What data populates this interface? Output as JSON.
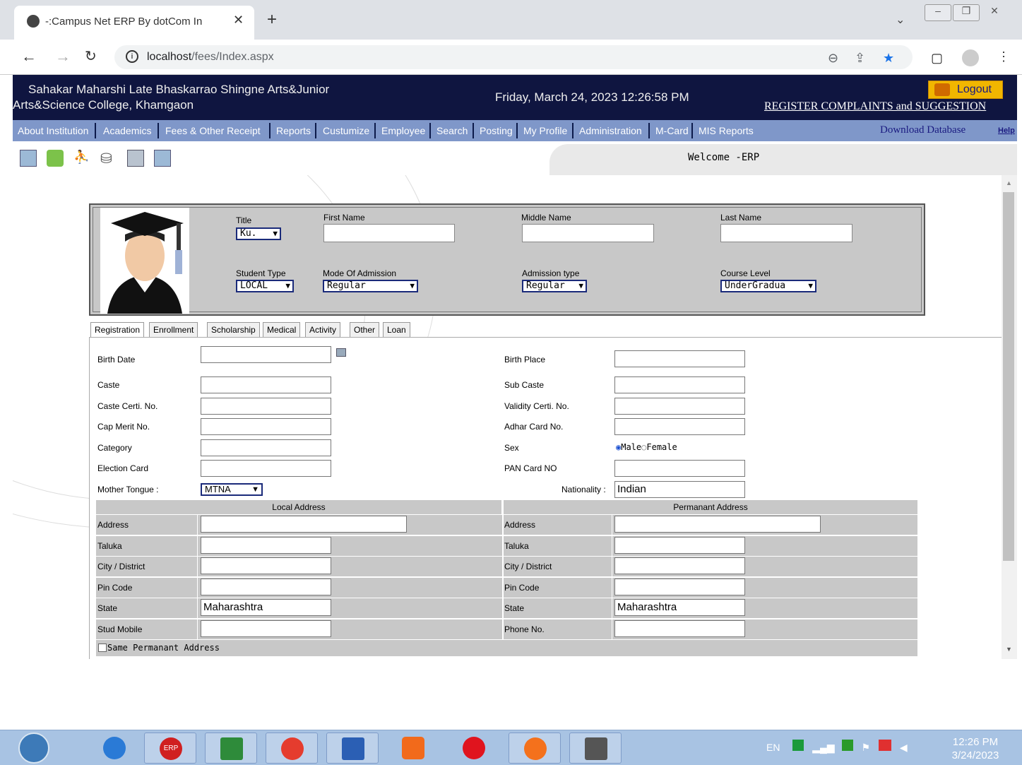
{
  "browser": {
    "tab_title": "-:Campus Net ERP By dotCom In",
    "url_host": "localhost",
    "url_path": "/fees/Index.aspx"
  },
  "header": {
    "college_line1": "Sahakar Maharshi Late Bhaskarrao Shingne Arts&Junior",
    "college_line2": "Arts&Science College, Khamgaon",
    "datetime": "Friday, March 24, 2023 12:26:58 PM",
    "logout": "Logout",
    "complaints": "REGISTER COMPLAINTS and SUGGESTION"
  },
  "menu": {
    "items": [
      "About Institution",
      "Academics",
      "Fees & Other Receipt",
      "Reports",
      "Custumize",
      "Employee",
      "Search",
      "Posting",
      "My Profile",
      "Administration",
      "M-Card",
      "MIS Reports"
    ],
    "download": "Download Database",
    "help": "Help"
  },
  "welcome": "Welcome -ERP",
  "profile": {
    "title_label": "Title",
    "title_value": "Ku.",
    "first_name_label": "First Name",
    "middle_name_label": "Middle Name",
    "last_name_label": "Last Name",
    "student_type_label": "Student Type",
    "student_type_value": "LOCAL",
    "mode_label": "Mode Of Admission",
    "mode_value": "Regular",
    "adm_type_label": "Admission type",
    "adm_type_value": "Regular",
    "course_level_label": "Course Level",
    "course_level_value": "UnderGradua"
  },
  "tabs": [
    "Registration",
    "Enrollment",
    "Scholarship",
    "Medical",
    "Activity",
    "Other",
    "Loan"
  ],
  "form": {
    "birth_date": "Birth Date",
    "birth_place": "Birth Place",
    "caste": "Caste",
    "sub_caste": "Sub Caste",
    "caste_certi": "Caste Certi. No.",
    "validity_certi": "Validity Certi. No.",
    "cap_merit": "Cap Merit No.",
    "adhar": "Adhar Card No.",
    "category": "Category",
    "sex": "Sex",
    "male": "Male",
    "female": "Female",
    "election": "Election Card",
    "pan": "PAN Card NO",
    "mother_tongue": "Mother Tongue :",
    "mother_tongue_value": "MTNA",
    "nationality": "Nationality :",
    "nationality_value": "Indian",
    "local_address": "Local Address",
    "permanent_address": "Permanant Address",
    "address": "Address",
    "taluka": "Taluka",
    "city": "City / District",
    "pin": "Pin Code",
    "state": "State",
    "state_value_local": "Maharashtra",
    "state_value_perm": "Maharashtra",
    "stud_mobile": "Stud Mobile",
    "phone": "Phone No.",
    "same_perm": "Same Permanant Address"
  },
  "taskbar": {
    "erp_label": "ERP",
    "lang": "EN",
    "time": "12:26 PM",
    "date": "3/24/2023"
  }
}
